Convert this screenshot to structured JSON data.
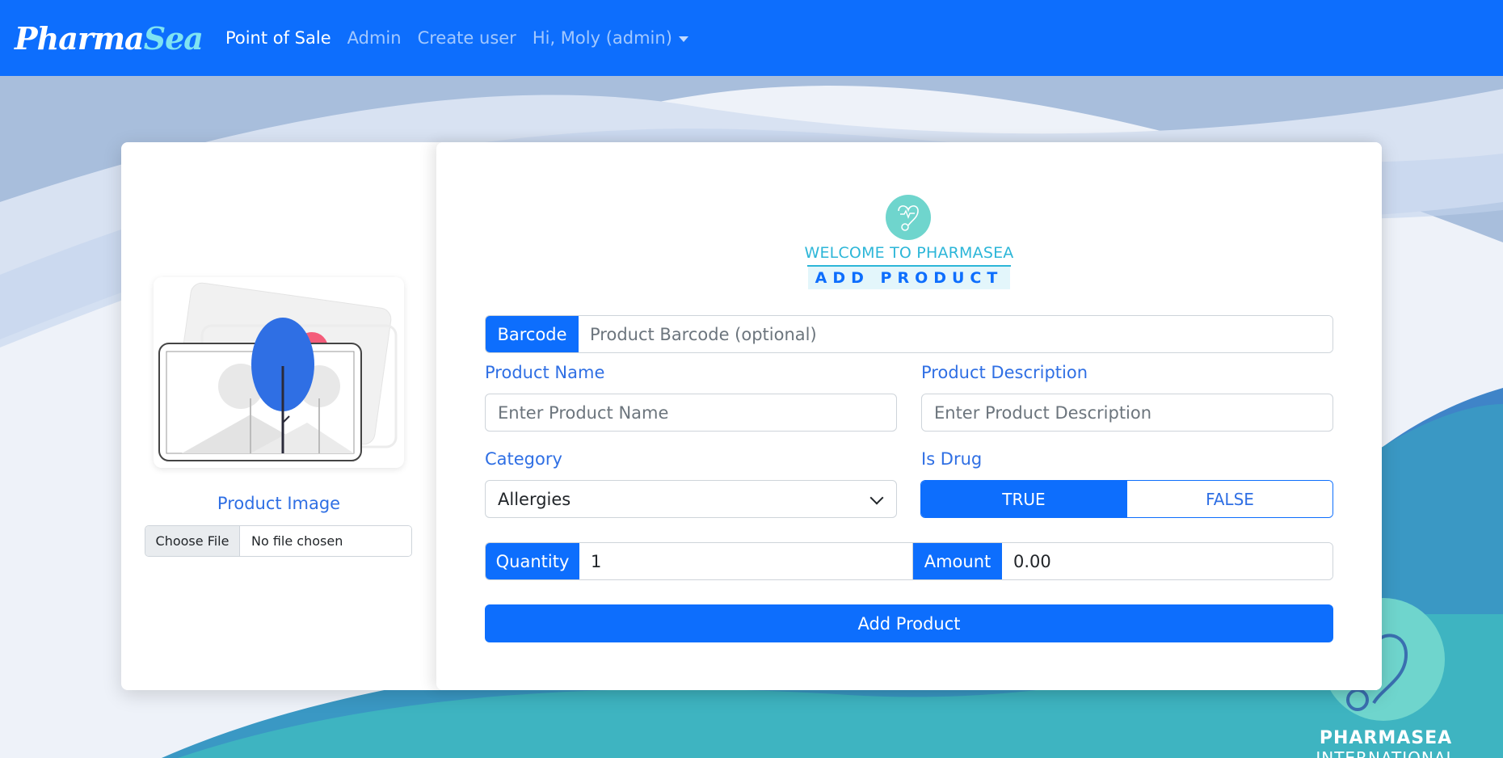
{
  "navbar": {
    "brand_part1": "Pharma",
    "brand_part2": "Sea",
    "links": [
      {
        "label": "Point of Sale",
        "active": true
      },
      {
        "label": "Admin",
        "active": false
      },
      {
        "label": "Create user",
        "active": false
      }
    ],
    "user_menu": "Hi, Moly (admin)"
  },
  "left_panel": {
    "image_label": "Product Image",
    "file_button": "Choose File",
    "file_status": "No file chosen"
  },
  "header": {
    "welcome": "WELCOME TO PHARMASEA",
    "title": "ADD PRODUCT"
  },
  "form": {
    "barcode": {
      "label": "Barcode",
      "placeholder": "Product Barcode (optional)"
    },
    "product_name": {
      "label": "Product Name",
      "placeholder": "Enter Product Name"
    },
    "product_description": {
      "label": "Product Description",
      "placeholder": "Enter Product Description"
    },
    "category": {
      "label": "Category",
      "value": "Allergies"
    },
    "is_drug": {
      "label": "Is Drug",
      "options": [
        "TRUE",
        "FALSE"
      ],
      "selected": "TRUE"
    },
    "quantity": {
      "label": "Quantity",
      "value": "1"
    },
    "amount": {
      "label": "Amount",
      "value": "0.00"
    },
    "submit_label": "Add Product"
  },
  "corner": {
    "line1": "PHARMASEA",
    "line2": "INTERNATIONAL"
  },
  "colors": {
    "primary": "#0d6efd",
    "teal": "#6fd5cd",
    "accent_text": "#2f6fe4"
  },
  "icons": [
    "stethoscope-heart-logo",
    "chevron-down-icon",
    "caret-down-icon",
    "tree-illustration"
  ]
}
